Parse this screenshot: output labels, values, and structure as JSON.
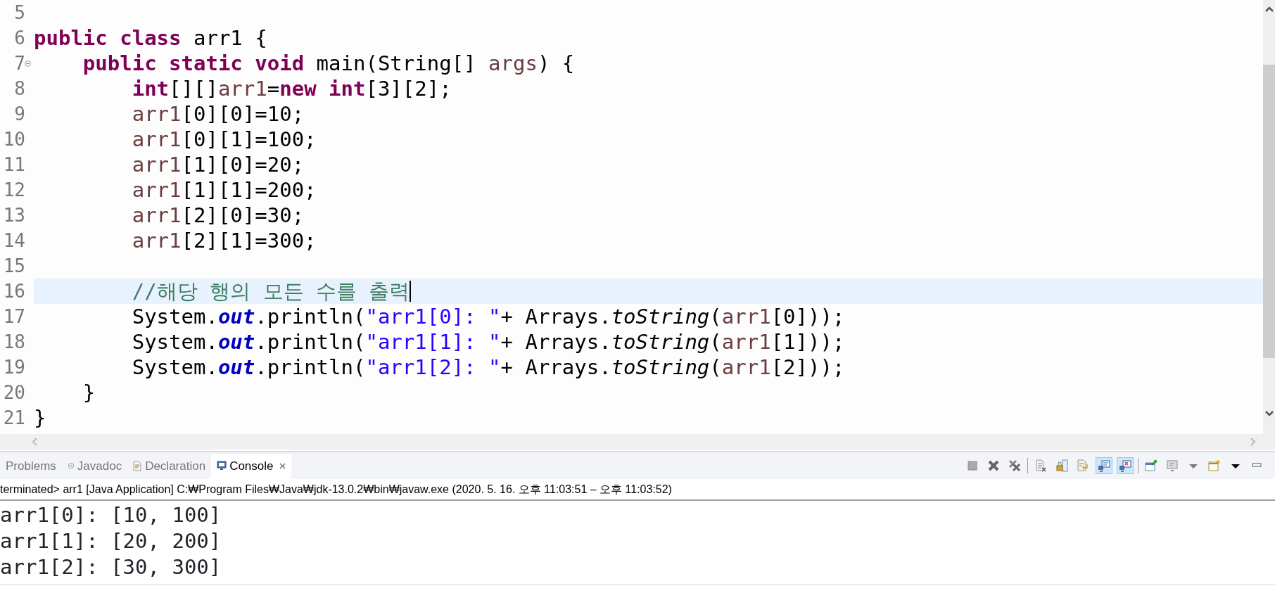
{
  "editor": {
    "lines": [
      {
        "number": "5",
        "current": false,
        "fold_marker": false
      },
      {
        "number": "6",
        "current": false,
        "fold_marker": false,
        "tokens": [
          {
            "kind": "keyword",
            "text": "public "
          },
          {
            "kind": "keyword",
            "text": "class"
          },
          {
            "kind": "plain",
            "text": " arr1 {"
          }
        ]
      },
      {
        "number": "7",
        "current": false,
        "fold_marker": true,
        "tokens": [
          {
            "kind": "keyword",
            "text": "    public "
          },
          {
            "kind": "keyword",
            "text": "static "
          },
          {
            "kind": "keyword",
            "text": "void"
          },
          {
            "kind": "plain",
            "text": " main(String[] "
          },
          {
            "kind": "variable",
            "text": "args"
          },
          {
            "kind": "plain",
            "text": ") {"
          }
        ]
      },
      {
        "number": "8",
        "current": false,
        "fold_marker": false,
        "tokens": [
          {
            "kind": "keyword",
            "text": "        int"
          },
          {
            "kind": "plain",
            "text": "[][]"
          },
          {
            "kind": "variable",
            "text": "arr1"
          },
          {
            "kind": "plain",
            "text": "="
          },
          {
            "kind": "keyword",
            "text": "new "
          },
          {
            "kind": "keyword",
            "text": "int"
          },
          {
            "kind": "plain",
            "text": "[3][2];"
          }
        ]
      },
      {
        "number": "9",
        "current": false,
        "fold_marker": false,
        "tokens": [
          {
            "kind": "variable",
            "text": "        arr1"
          },
          {
            "kind": "plain",
            "text": "[0][0]=10;"
          }
        ]
      },
      {
        "number": "10",
        "current": false,
        "fold_marker": false,
        "tokens": [
          {
            "kind": "variable",
            "text": "        arr1"
          },
          {
            "kind": "plain",
            "text": "[0][1]=100;"
          }
        ]
      },
      {
        "number": "11",
        "current": false,
        "fold_marker": false,
        "tokens": [
          {
            "kind": "variable",
            "text": "        arr1"
          },
          {
            "kind": "plain",
            "text": "[1][0]=20;"
          }
        ]
      },
      {
        "number": "12",
        "current": false,
        "fold_marker": false,
        "tokens": [
          {
            "kind": "variable",
            "text": "        arr1"
          },
          {
            "kind": "plain",
            "text": "[1][1]=200;"
          }
        ]
      },
      {
        "number": "13",
        "current": false,
        "fold_marker": false,
        "tokens": [
          {
            "kind": "variable",
            "text": "        arr1"
          },
          {
            "kind": "plain",
            "text": "[2][0]=30;"
          }
        ]
      },
      {
        "number": "14",
        "current": false,
        "fold_marker": false,
        "tokens": [
          {
            "kind": "variable",
            "text": "        arr1"
          },
          {
            "kind": "plain",
            "text": "[2][1]=300;"
          }
        ]
      },
      {
        "number": "15",
        "current": false,
        "fold_marker": false
      },
      {
        "number": "16",
        "current": true,
        "fold_marker": false,
        "tokens": [
          {
            "kind": "comment",
            "text": "        //해당 행의 모든 수를 출력"
          }
        ]
      },
      {
        "number": "17",
        "current": false,
        "fold_marker": false,
        "tokens": [
          {
            "kind": "plain",
            "text": "        System."
          },
          {
            "kind": "field",
            "text": "out"
          },
          {
            "kind": "plain",
            "text": ".println("
          },
          {
            "kind": "string",
            "text": "\"arr1[0]: \""
          },
          {
            "kind": "plain",
            "text": "+ Arrays."
          },
          {
            "kind": "static_method",
            "text": "toString"
          },
          {
            "kind": "plain",
            "text": "("
          },
          {
            "kind": "variable",
            "text": "arr1"
          },
          {
            "kind": "plain",
            "text": "[0]));"
          }
        ]
      },
      {
        "number": "18",
        "current": false,
        "fold_marker": false,
        "tokens": [
          {
            "kind": "plain",
            "text": "        System."
          },
          {
            "kind": "field",
            "text": "out"
          },
          {
            "kind": "plain",
            "text": ".println("
          },
          {
            "kind": "string",
            "text": "\"arr1[1]: \""
          },
          {
            "kind": "plain",
            "text": "+ Arrays."
          },
          {
            "kind": "static_method",
            "text": "toString"
          },
          {
            "kind": "plain",
            "text": "("
          },
          {
            "kind": "variable",
            "text": "arr1"
          },
          {
            "kind": "plain",
            "text": "[1]));"
          }
        ]
      },
      {
        "number": "19",
        "current": false,
        "fold_marker": false,
        "tokens": [
          {
            "kind": "plain",
            "text": "        System."
          },
          {
            "kind": "field",
            "text": "out"
          },
          {
            "kind": "plain",
            "text": ".println("
          },
          {
            "kind": "string",
            "text": "\"arr1[2]: \""
          },
          {
            "kind": "plain",
            "text": "+ Arrays."
          },
          {
            "kind": "static_method",
            "text": "toString"
          },
          {
            "kind": "plain",
            "text": "("
          },
          {
            "kind": "variable",
            "text": "arr1"
          },
          {
            "kind": "plain",
            "text": "[2]));"
          }
        ]
      },
      {
        "number": "20",
        "current": false,
        "fold_marker": false,
        "tokens": [
          {
            "kind": "plain",
            "text": "    }"
          }
        ]
      },
      {
        "number": "21",
        "current": false,
        "fold_marker": false,
        "tokens": [
          {
            "kind": "plain",
            "text": "}"
          }
        ]
      }
    ]
  },
  "panel": {
    "tabs": [
      {
        "label": "Problems",
        "selected": false,
        "closable": false
      },
      {
        "label": "Javadoc",
        "selected": false,
        "closable": false
      },
      {
        "label": "Declaration",
        "selected": false,
        "closable": false
      },
      {
        "label": "Console",
        "selected": true,
        "closable": true
      }
    ],
    "toolbar": [
      {
        "kind": "stop",
        "on": false
      },
      {
        "kind": "remove",
        "on": false
      },
      {
        "kind": "remove-all",
        "on": false
      },
      {
        "kind": "separator",
        "on": false
      },
      {
        "kind": "clear",
        "on": false
      },
      {
        "kind": "scroll-lock",
        "on": false
      },
      {
        "kind": "word-wrap",
        "on": false
      },
      {
        "kind": "show-stdout",
        "on": true
      },
      {
        "kind": "show-stderr",
        "on": true
      },
      {
        "kind": "separator",
        "on": false
      },
      {
        "kind": "pin",
        "on": false
      },
      {
        "kind": "display",
        "on": false
      },
      {
        "kind": "dropdown",
        "on": false
      },
      {
        "kind": "new-console",
        "on": false
      },
      {
        "kind": "dropdown-dark",
        "on": false
      },
      {
        "kind": "minimize",
        "on": false
      }
    ],
    "console": {
      "header": "terminated> arr1 [Java Application] C:₩Program Files₩Java₩jdk-13.0.2₩bin₩javaw.exe  (2020. 5. 16. 오후 11:03:51 – 오후 11:03:52)",
      "output": [
        "arr1[0]: [10, 100]",
        "arr1[1]: [20, 200]",
        "arr1[2]: [30, 300]"
      ]
    }
  }
}
